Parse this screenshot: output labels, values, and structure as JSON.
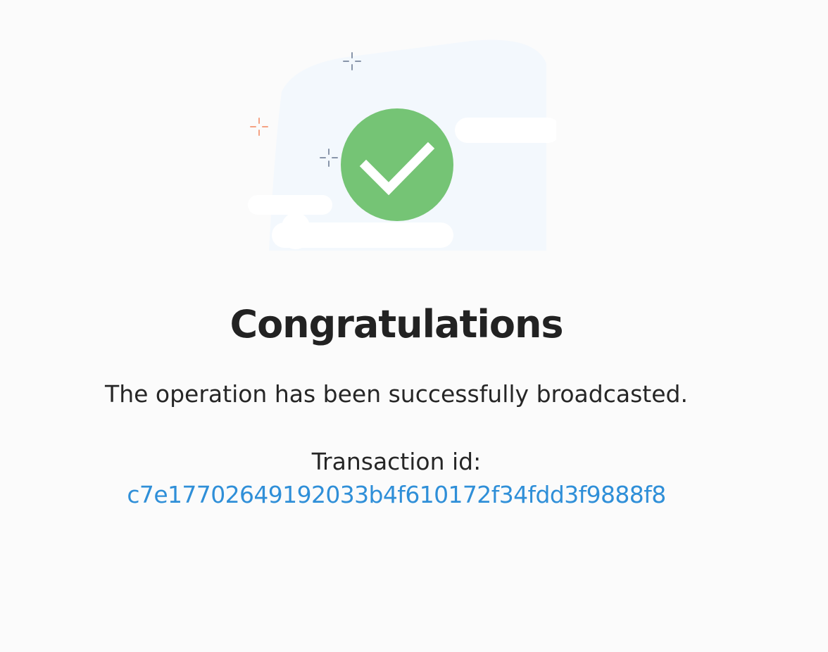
{
  "illustration": {
    "icon": "success-checkmark-icon",
    "badge_color": "#75c475",
    "sparkle_colors": [
      "#8895aa",
      "#f5a284"
    ],
    "backdrop_color": "#f3f8fd"
  },
  "result": {
    "title": "Congratulations",
    "message": "The operation has been successfully broadcasted.",
    "transaction_label": "Transaction id:",
    "transaction_id": "c7e17702649192033b4f610172f34fdd3f9888f8",
    "link_color": "#2f8fd8"
  }
}
